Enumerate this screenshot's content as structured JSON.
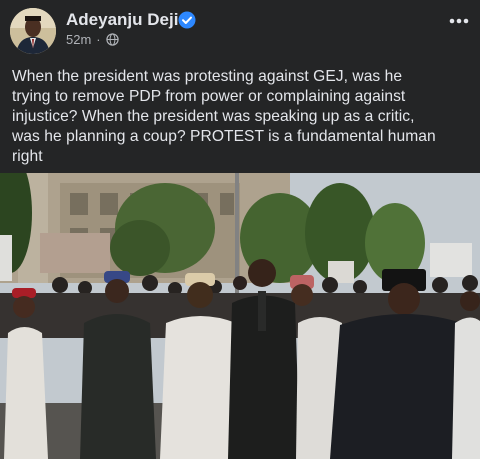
{
  "post": {
    "author_name": "Adeyanju Deji",
    "timestamp": "52m",
    "audience_icon": "globe-icon",
    "verified_icon": "verified-badge-icon",
    "more_icon": "more-options-icon",
    "text_lines": [
      "When the president was protesting against GEJ, was he",
      "trying to remove PDP from power or complaining against",
      "injustice? When the president was speaking up as a critic,",
      "was he planning a coup? PROTEST is a fundamental human",
      "right"
    ]
  },
  "photo": {
    "sign_text": "",
    "colors": {
      "sky": "#cfd6dc",
      "building": "#b9ad97",
      "trees": "#4a6b34",
      "ground": "#5c5a55"
    }
  },
  "colors": {
    "background": "#242526",
    "primary_text": "#e4e6eb",
    "secondary_text": "#b0b3b8",
    "verified_blue": "#2d88ff"
  }
}
